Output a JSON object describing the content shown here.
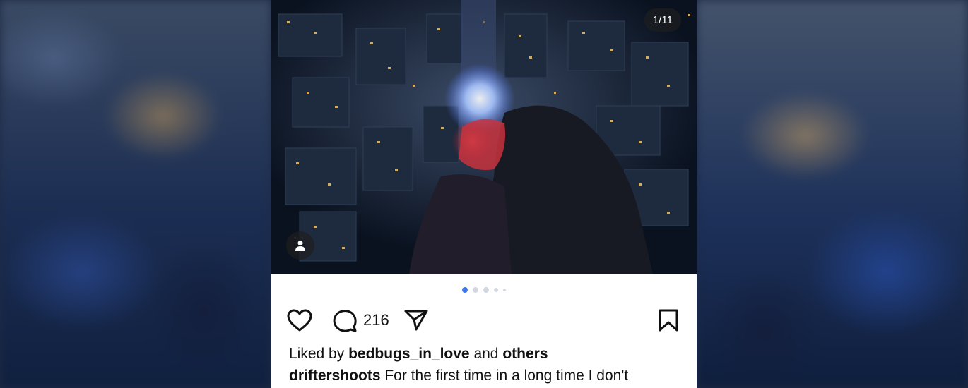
{
  "post": {
    "image_counter": "1/11",
    "comment_count": "216",
    "liked_by_prefix": "Liked by",
    "liked_by_user": "bedbugs_in_love",
    "liked_by_and": "and",
    "liked_by_others": "others",
    "caption_user": "driftershoots",
    "caption_text": "For the first time in a long time I don't",
    "carousel": {
      "total_dots": 5,
      "active_index": 0
    }
  },
  "icons": {
    "like": "heart-icon",
    "comment": "speech-bubble-icon",
    "share": "paper-plane-icon",
    "save": "bookmark-icon",
    "tags": "person-icon"
  }
}
